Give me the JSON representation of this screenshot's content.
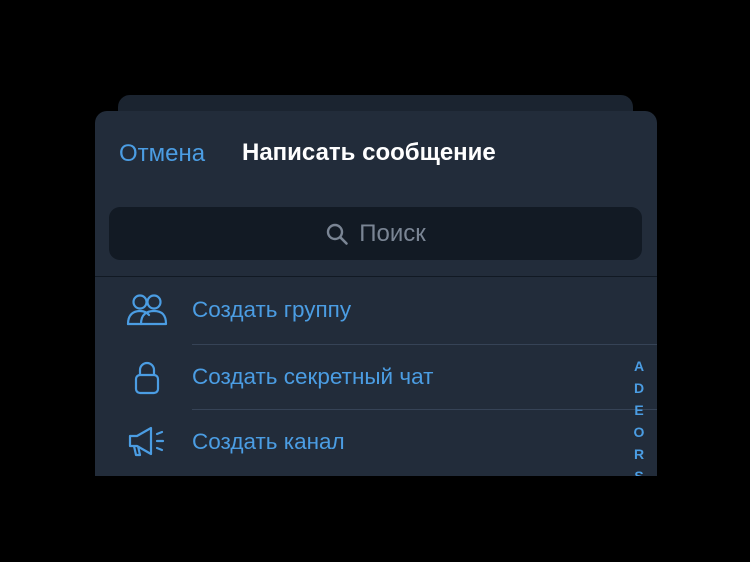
{
  "header": {
    "cancel_label": "Отмена",
    "title": "Написать сообщение"
  },
  "search": {
    "placeholder": "Поиск",
    "icon": "search-icon"
  },
  "actions": [
    {
      "label": "Создать группу",
      "icon": "group-icon"
    },
    {
      "label": "Создать секретный чат",
      "icon": "lock-icon"
    },
    {
      "label": "Создать канал",
      "icon": "megaphone-icon"
    }
  ],
  "index_letters": [
    "A",
    "D",
    "E",
    "O",
    "R",
    "S"
  ],
  "colors": {
    "accent": "#4b9de3",
    "background": "#222c3a",
    "search_bg": "#121a24"
  }
}
